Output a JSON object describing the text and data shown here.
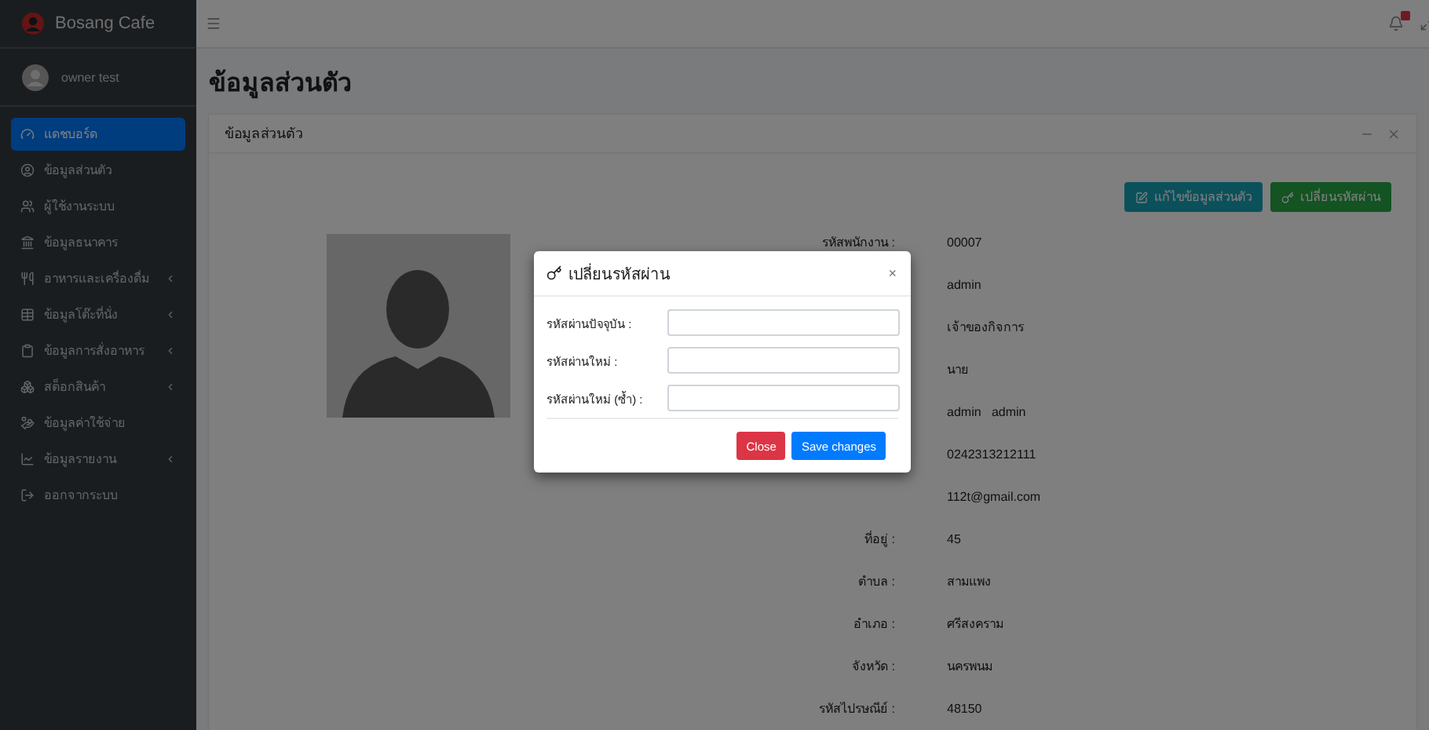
{
  "brand": {
    "name": "Bosang Cafe"
  },
  "user": {
    "name": "owner test"
  },
  "sidebar": {
    "items": [
      {
        "label": "แดชบอร์ด",
        "selected": true,
        "expandable": false
      },
      {
        "label": "ข้อมูลส่วนตัว",
        "selected": false,
        "expandable": false
      },
      {
        "label": "ผู้ใช้งานระบบ",
        "selected": false,
        "expandable": false
      },
      {
        "label": "ข้อมูลธนาคาร",
        "selected": false,
        "expandable": false
      },
      {
        "label": "อาหารและเครื่องดื่ม",
        "selected": false,
        "expandable": true
      },
      {
        "label": "ข้อมูลโต๊ะที่นั่ง",
        "selected": false,
        "expandable": true
      },
      {
        "label": "ข้อมูลการสั่งอาหาร",
        "selected": false,
        "expandable": true
      },
      {
        "label": "สต็อกสินค้า",
        "selected": false,
        "expandable": true
      },
      {
        "label": "ข้อมูลค่าใช้จ่าย",
        "selected": false,
        "expandable": false
      },
      {
        "label": "ข้อมูลรายงาน",
        "selected": false,
        "expandable": true
      },
      {
        "label": "ออกจากระบบ",
        "selected": false,
        "expandable": false
      }
    ]
  },
  "page_title": "ข้อมูลส่วนตัว",
  "card": {
    "title": "ข้อมูลส่วนตัว",
    "actions": [
      {
        "label": "แก้ไขข้อมูลส่วนตัว",
        "kind": "edit"
      },
      {
        "label": "เปลี่ยนรหัสผ่าน",
        "kind": "password"
      }
    ],
    "profile": [
      {
        "label": "รหัสพนักงาน :",
        "value": "00007"
      },
      {
        "value": "admin"
      },
      {
        "value": "เจ้าของกิจการ"
      },
      {
        "value": "นาย"
      },
      {
        "value": "admin   admin"
      },
      {
        "value": "0242313212111"
      },
      {
        "value": "112t@gmail.com"
      },
      {
        "label": "ที่อยู่ :",
        "value": "45"
      },
      {
        "label": "ตำบล :",
        "value": "สามแพง"
      },
      {
        "label": "อำเภอ :",
        "value": "ศรีสงคราม"
      },
      {
        "label": "จังหวัด :",
        "value": "นครพนม"
      },
      {
        "label": "รหัสไปรษณีย์ :",
        "value": "48150"
      }
    ]
  },
  "modal": {
    "title": "เปลี่ยนรหัสผ่าน",
    "close_symbol": "×",
    "fields": [
      {
        "label": "รหัสผ่านปัจจุบัน :"
      },
      {
        "label": "รหัสผ่านใหม่ :"
      },
      {
        "label": "รหัสผ่านใหม่ (ซ้ำ) :"
      }
    ],
    "buttons": [
      {
        "label": "Close",
        "kind": "secondary"
      },
      {
        "label": "Save changes",
        "kind": "primary"
      }
    ]
  }
}
